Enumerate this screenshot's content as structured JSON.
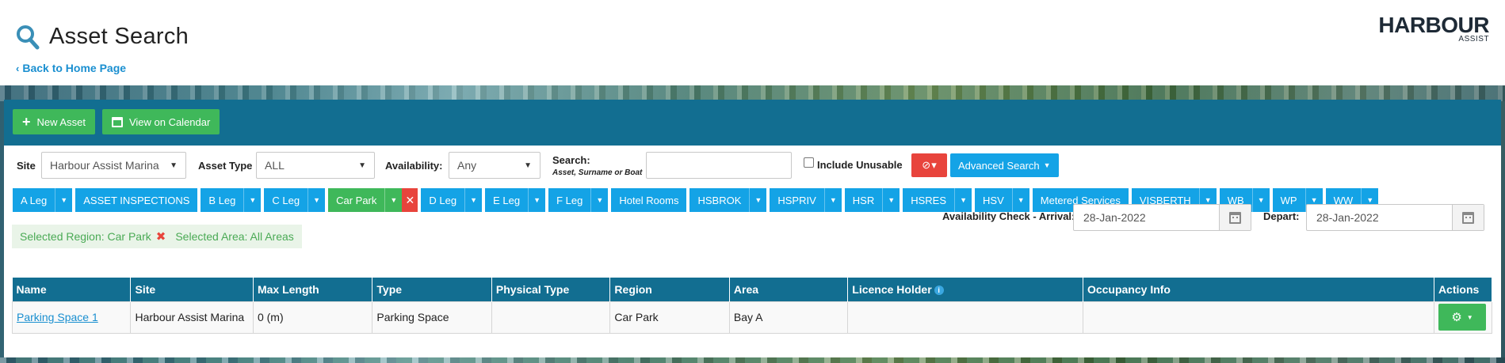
{
  "header": {
    "title": "Asset Search",
    "back_link": "Back to Home Page",
    "logo": {
      "main": "HARBOUR",
      "sub": "ASSIST"
    }
  },
  "toolbar": {
    "new_asset": "New Asset",
    "view_calendar": "View on Calendar"
  },
  "filters": {
    "site_label": "Site",
    "site_value": "Harbour Assist Marina",
    "asset_type_label": "Asset Type",
    "asset_type_value": "ALL",
    "availability_label": "Availability:",
    "availability_value": "Any",
    "search_label": "Search:",
    "search_sublabel": "Asset, Surname or Boat",
    "search_value": "",
    "include_unusable_label": "Include Unusable",
    "advanced_search": "Advanced Search"
  },
  "regions": [
    {
      "label": "A Leg",
      "caret": true,
      "active": false
    },
    {
      "label": "ASSET INSPECTIONS",
      "caret": false,
      "active": false
    },
    {
      "label": "B Leg",
      "caret": true,
      "active": false
    },
    {
      "label": "C Leg",
      "caret": true,
      "active": false
    },
    {
      "label": "Car Park",
      "caret": true,
      "active": true
    },
    {
      "label": "D Leg",
      "caret": true,
      "active": false
    },
    {
      "label": "E Leg",
      "caret": true,
      "active": false
    },
    {
      "label": "F Leg",
      "caret": true,
      "active": false
    },
    {
      "label": "Hotel Rooms",
      "caret": false,
      "active": false
    },
    {
      "label": "HSBROK",
      "caret": true,
      "active": false
    },
    {
      "label": "HSPRIV",
      "caret": true,
      "active": false
    },
    {
      "label": "HSR",
      "caret": true,
      "active": false
    },
    {
      "label": "HSRES",
      "caret": true,
      "active": false
    },
    {
      "label": "HSV",
      "caret": true,
      "active": false
    },
    {
      "label": "Metered Services",
      "caret": false,
      "active": false
    },
    {
      "label": "VISBERTH",
      "caret": true,
      "active": false
    },
    {
      "label": "WB",
      "caret": true,
      "active": false
    },
    {
      "label": "WP",
      "caret": true,
      "active": false
    },
    {
      "label": "WW",
      "caret": true,
      "active": false
    }
  ],
  "selection": {
    "region": "Selected Region: Car Park",
    "area": "Selected Area: All Areas"
  },
  "availability": {
    "arrival_label": "Availability Check - Arrival:",
    "arrival_value": "28-Jan-2022",
    "depart_label": "Depart:",
    "depart_value": "28-Jan-2022"
  },
  "table": {
    "headers": [
      "Name",
      "Site",
      "Max Length",
      "Type",
      "Physical Type",
      "Region",
      "Area",
      "Licence Holder",
      "Occupancy Info",
      "Actions"
    ],
    "rows": [
      {
        "name": "Parking Space 1",
        "site": "Harbour Assist Marina",
        "max_length": "0 (m)",
        "type": "Parking Space",
        "physical_type": "",
        "region": "Car Park",
        "area": "Bay A",
        "licence_holder": "",
        "occupancy_info": ""
      }
    ]
  },
  "colors": {
    "primary_dark": "#126e91",
    "primary_blue": "#14a3e6",
    "success": "#3fb85a",
    "danger": "#e8443c",
    "link": "#1a8fd0"
  }
}
